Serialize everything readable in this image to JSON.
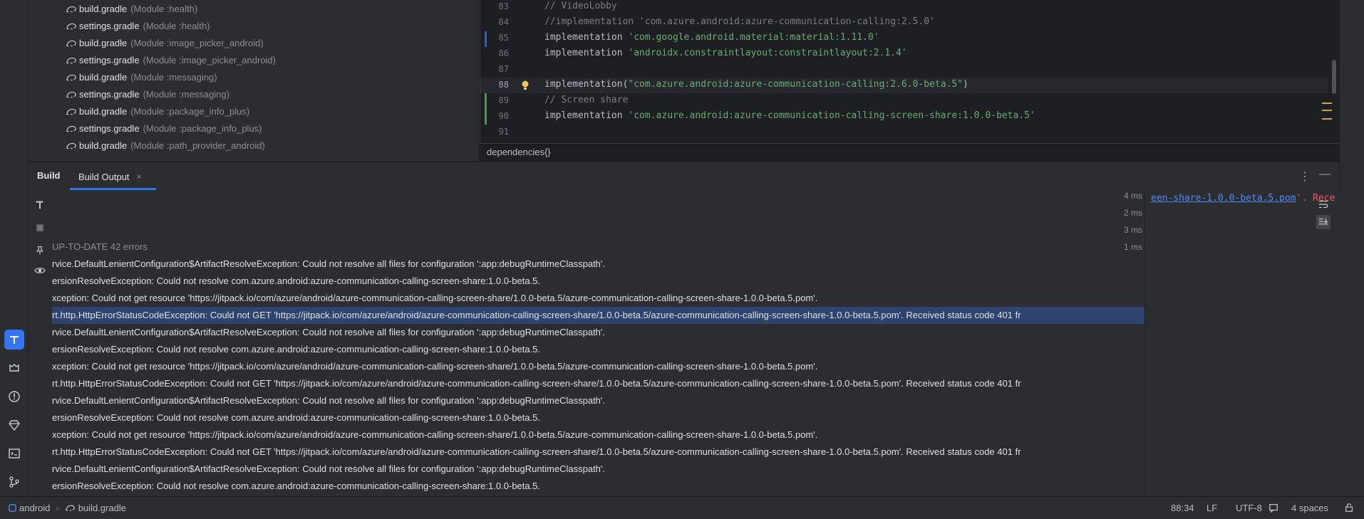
{
  "tree": {
    "items": [
      {
        "name": "build.gradle",
        "module": "(Module :health)"
      },
      {
        "name": "settings.gradle",
        "module": "(Module :health)"
      },
      {
        "name": "build.gradle",
        "module": "(Module :image_picker_android)"
      },
      {
        "name": "settings.gradle",
        "module": "(Module :image_picker_android)"
      },
      {
        "name": "build.gradle",
        "module": "(Module :messaging)"
      },
      {
        "name": "settings.gradle",
        "module": "(Module :messaging)"
      },
      {
        "name": "build.gradle",
        "module": "(Module :package_info_plus)"
      },
      {
        "name": "settings.gradle",
        "module": "(Module :package_info_plus)"
      },
      {
        "name": "build.gradle",
        "module": "(Module :path_provider_android)"
      }
    ]
  },
  "editor": {
    "lines": [
      {
        "num": "83",
        "type": "comment",
        "text": "// VideoLobby"
      },
      {
        "num": "84",
        "type": "comment",
        "text": "//implementation 'com.azure.android:azure-communication-calling:2.5.0'"
      },
      {
        "num": "85",
        "type": "dep",
        "kw": "implementation ",
        "str": "'com.google.android.material:material:1.11.0'"
      },
      {
        "num": "86",
        "type": "dep",
        "kw": "implementation ",
        "str": "'androidx.constraintlayout:constraintlayout:2.1.4'"
      },
      {
        "num": "87",
        "type": "blank",
        "text": ""
      },
      {
        "num": "88",
        "type": "call",
        "kw": "implementation(",
        "str": "\"com.azure.android:azure-communication-calling:2.6.0-beta.5\"",
        "end": ")"
      },
      {
        "num": "89",
        "type": "comment",
        "text": "// Screen share"
      },
      {
        "num": "90",
        "type": "dep",
        "kw": "implementation ",
        "str": "'com.azure.android:azure-communication-calling-screen-share:1.0.0-beta.5'"
      },
      {
        "num": "91",
        "type": "blank",
        "text": ""
      }
    ],
    "breadcrumb": "dependencies{}"
  },
  "toolwindow": {
    "title": "Build",
    "tab_label": "Build Output",
    "tab_close": "×"
  },
  "output": {
    "lines": [
      {
        "text": "",
        "ms": "4 ms"
      },
      {
        "text": "",
        "ms": "2 ms"
      },
      {
        "text": "",
        "ms": "3 ms"
      },
      {
        "text": "UP-TO-DATE 42 errors",
        "ms": "1 ms",
        "header": true
      },
      {
        "text": "rvice.DefaultLenientConfiguration$ArtifactResolveException: Could not resolve all files for configuration ':app:debugRuntimeClasspath'.",
        "ms": ""
      },
      {
        "text": "ersionResolveException: Could not resolve com.azure.android:azure-communication-calling-screen-share:1.0.0-beta.5.",
        "ms": ""
      },
      {
        "text": "xception: Could not get resource 'https://jitpack.io/com/azure/android/azure-communication-calling-screen-share/1.0.0-beta.5/azure-communication-calling-screen-share-1.0.0-beta.5.pom'.",
        "ms": ""
      },
      {
        "text": "rt.http.HttpErrorStatusCodeException: Could not GET 'https://jitpack.io/com/azure/android/azure-communication-calling-screen-share/1.0.0-beta.5/azure-communication-calling-screen-share-1.0.0-beta.5.pom'. Received status code 401 fr",
        "ms": "",
        "selected": true
      },
      {
        "text": "rvice.DefaultLenientConfiguration$ArtifactResolveException: Could not resolve all files for configuration ':app:debugRuntimeClasspath'.",
        "ms": ""
      },
      {
        "text": "ersionResolveException: Could not resolve com.azure.android:azure-communication-calling-screen-share:1.0.0-beta.5.",
        "ms": ""
      },
      {
        "text": "xception: Could not get resource 'https://jitpack.io/com/azure/android/azure-communication-calling-screen-share/1.0.0-beta.5/azure-communication-calling-screen-share-1.0.0-beta.5.pom'.",
        "ms": ""
      },
      {
        "text": "rt.http.HttpErrorStatusCodeException: Could not GET 'https://jitpack.io/com/azure/android/azure-communication-calling-screen-share/1.0.0-beta.5/azure-communication-calling-screen-share-1.0.0-beta.5.pom'. Received status code 401 fr",
        "ms": ""
      },
      {
        "text": "rvice.DefaultLenientConfiguration$ArtifactResolveException: Could not resolve all files for configuration ':app:debugRuntimeClasspath'.",
        "ms": ""
      },
      {
        "text": "ersionResolveException: Could not resolve com.azure.android:azure-communication-calling-screen-share:1.0.0-beta.5.",
        "ms": ""
      },
      {
        "text": "xception: Could not get resource 'https://jitpack.io/com/azure/android/azure-communication-calling-screen-share/1.0.0-beta.5/azure-communication-calling-screen-share-1.0.0-beta.5.pom'.",
        "ms": ""
      },
      {
        "text": "rt.http.HttpErrorStatusCodeException: Could not GET 'https://jitpack.io/com/azure/android/azure-communication-calling-screen-share/1.0.0-beta.5/azure-communication-calling-screen-share-1.0.0-beta.5.pom'. Received status code 401 fr",
        "ms": ""
      },
      {
        "text": "rvice.DefaultLenientConfiguration$ArtifactResolveException: Could not resolve all files for configuration ':app:debugRuntimeClasspath'.",
        "ms": ""
      },
      {
        "text": "ersionResolveException: Could not resolve com.azure.android:azure-communication-calling-screen-share:1.0.0-beta.5.",
        "ms": ""
      }
    ],
    "detail_link": "een-share-1.0.0-beta.5.pom",
    "detail_rest": "'. Rece"
  },
  "status": {
    "project": "android",
    "file": "build.gradle",
    "position": "88:34",
    "line_sep": "LF",
    "encoding": "UTF-8",
    "indent": "4 spaces"
  },
  "colors": {
    "accent": "#3574f0",
    "selection": "#2e436e",
    "string": "#6aab73",
    "error": "#f75464",
    "link": "#548af7"
  }
}
